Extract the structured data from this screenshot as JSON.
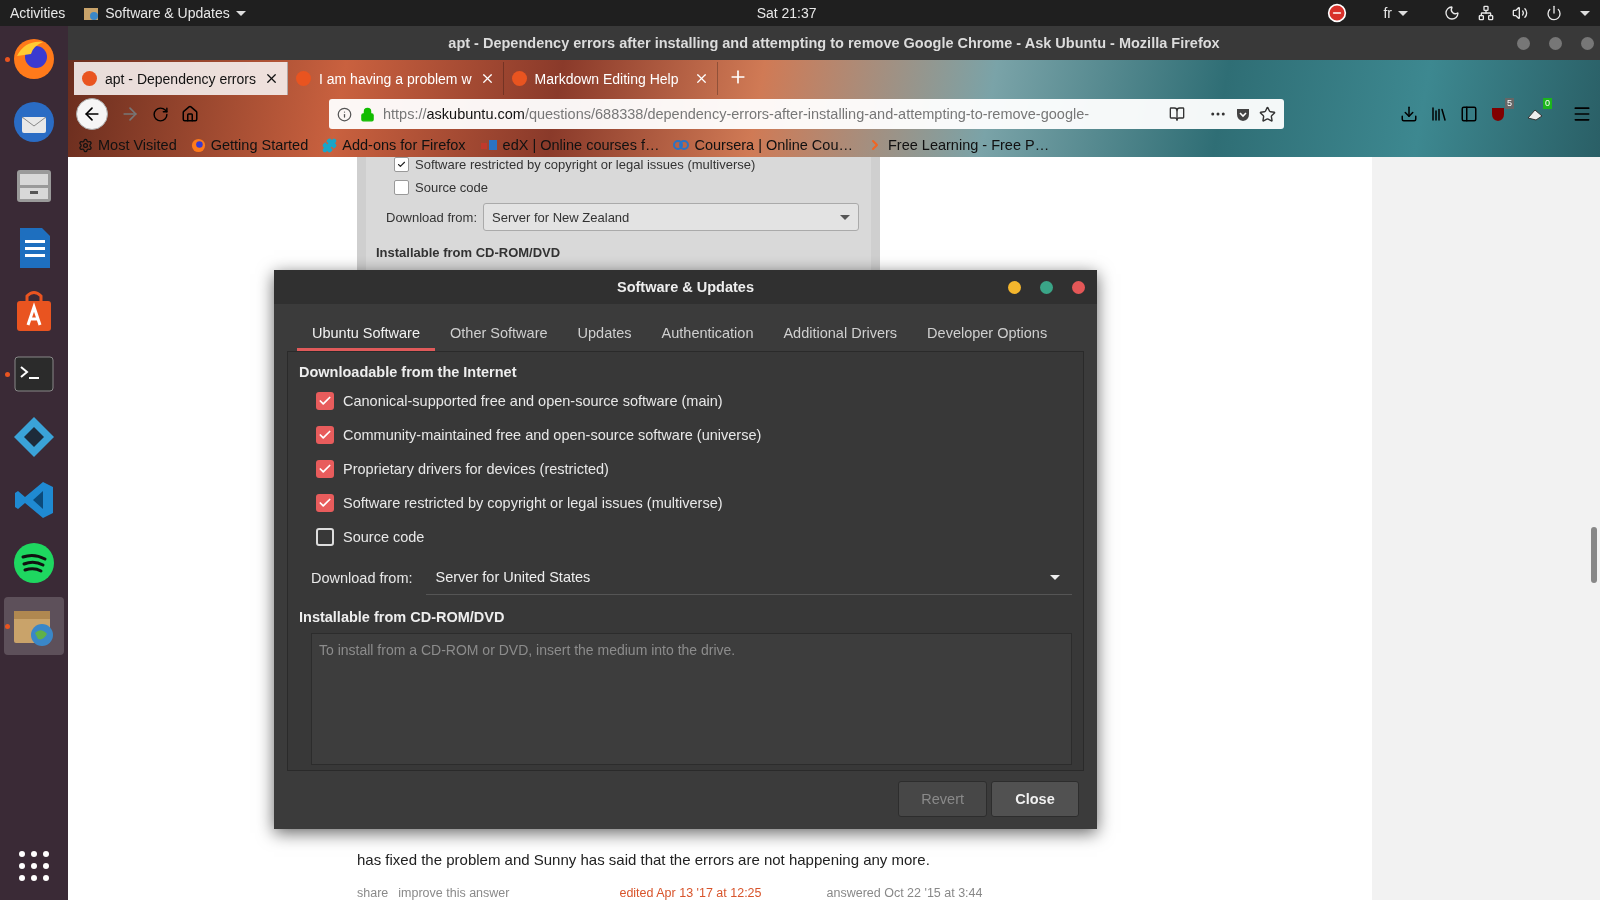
{
  "top_bar": {
    "activities": "Activities",
    "app_menu": "Software & Updates",
    "clock": "Sat 21:37",
    "keyboard_layout": "fr"
  },
  "dock": {
    "items": [
      {
        "kind": "firefox",
        "running": true,
        "selected": false
      },
      {
        "kind": "thunderbird",
        "running": false,
        "selected": false
      },
      {
        "kind": "files",
        "running": false,
        "selected": false
      },
      {
        "kind": "writer",
        "running": false,
        "selected": false
      },
      {
        "kind": "software-center",
        "running": false,
        "selected": false
      },
      {
        "kind": "terminal",
        "running": true,
        "selected": false
      },
      {
        "kind": "kodi",
        "running": false,
        "selected": false
      },
      {
        "kind": "vscode",
        "running": false,
        "selected": false
      },
      {
        "kind": "spotify",
        "running": false,
        "selected": false
      },
      {
        "kind": "software-updates",
        "running": true,
        "selected": true
      }
    ]
  },
  "browser": {
    "window_title": "apt - Dependency errors after installing and attempting to remove Google Chrome - Ask Ubuntu - Mozilla Firefox",
    "tabs": [
      {
        "title": "apt - Dependency errors",
        "selected": true
      },
      {
        "title": "I am having a problem w",
        "selected": false
      },
      {
        "title": "Markdown Editing Help",
        "selected": false
      }
    ],
    "url": {
      "scheme": "https://",
      "host": "askubuntu.com",
      "path": "/questions/688338/dependency-errors-after-installing-and-attempting-to-remove-google-"
    },
    "badges": {
      "blocker": "5",
      "extension": "0"
    },
    "bookmarks": [
      {
        "kind": "gear",
        "label": "Most Visited"
      },
      {
        "kind": "firefox",
        "label": "Getting Started"
      },
      {
        "kind": "puzzle",
        "label": "Add-ons for Firefox"
      },
      {
        "kind": "edx",
        "label": "edX | Online courses f…"
      },
      {
        "kind": "coursera",
        "label": "Coursera | Online Cou…"
      },
      {
        "kind": "chevron",
        "label": "Free Learning - Free P…"
      }
    ]
  },
  "page": {
    "screenshot": {
      "rows": [
        {
          "label": "Software restricted by copyright or legal issues (multiverse)",
          "checked": true
        },
        {
          "label": "Source code",
          "checked": false
        }
      ],
      "download_label": "Download from:",
      "server": "Server for New Zealand",
      "section": "Installable from CD-ROM/DVD"
    },
    "answer_text": "has fixed the problem and Sunny has said that the errors are not happening any more.",
    "links": [
      "share",
      "improve this answer"
    ],
    "edited": "edited Apr 13 '17 at 12:25",
    "answered": "answered Oct 22 '15 at 3:44"
  },
  "dialog": {
    "title": "Software & Updates",
    "tabs": [
      {
        "label": "Ubuntu Software",
        "selected": true
      },
      {
        "label": "Other Software",
        "selected": false
      },
      {
        "label": "Updates",
        "selected": false
      },
      {
        "label": "Authentication",
        "selected": false
      },
      {
        "label": "Additional Drivers",
        "selected": false
      },
      {
        "label": "Developer Options",
        "selected": false
      }
    ],
    "section": "Downloadable from the Internet",
    "sources": [
      {
        "label": "Canonical-supported free and open-source software (main)",
        "checked": true
      },
      {
        "label": "Community-maintained free and open-source software (universe)",
        "checked": true
      },
      {
        "label": "Proprietary drivers for devices (restricted)",
        "checked": true
      },
      {
        "label": "Software restricted by copyright or legal issues (multiverse)",
        "checked": true
      },
      {
        "label": "Source code",
        "checked": false
      }
    ],
    "download_label": "Download from:",
    "server": "Server for United States",
    "cd_section": "Installable from CD-ROM/DVD",
    "cd_placeholder": "To install from a CD-ROM or DVD, insert the medium into the drive.",
    "buttons": [
      {
        "label": "Revert",
        "disabled": true
      },
      {
        "label": "Close",
        "disabled": false
      }
    ]
  }
}
